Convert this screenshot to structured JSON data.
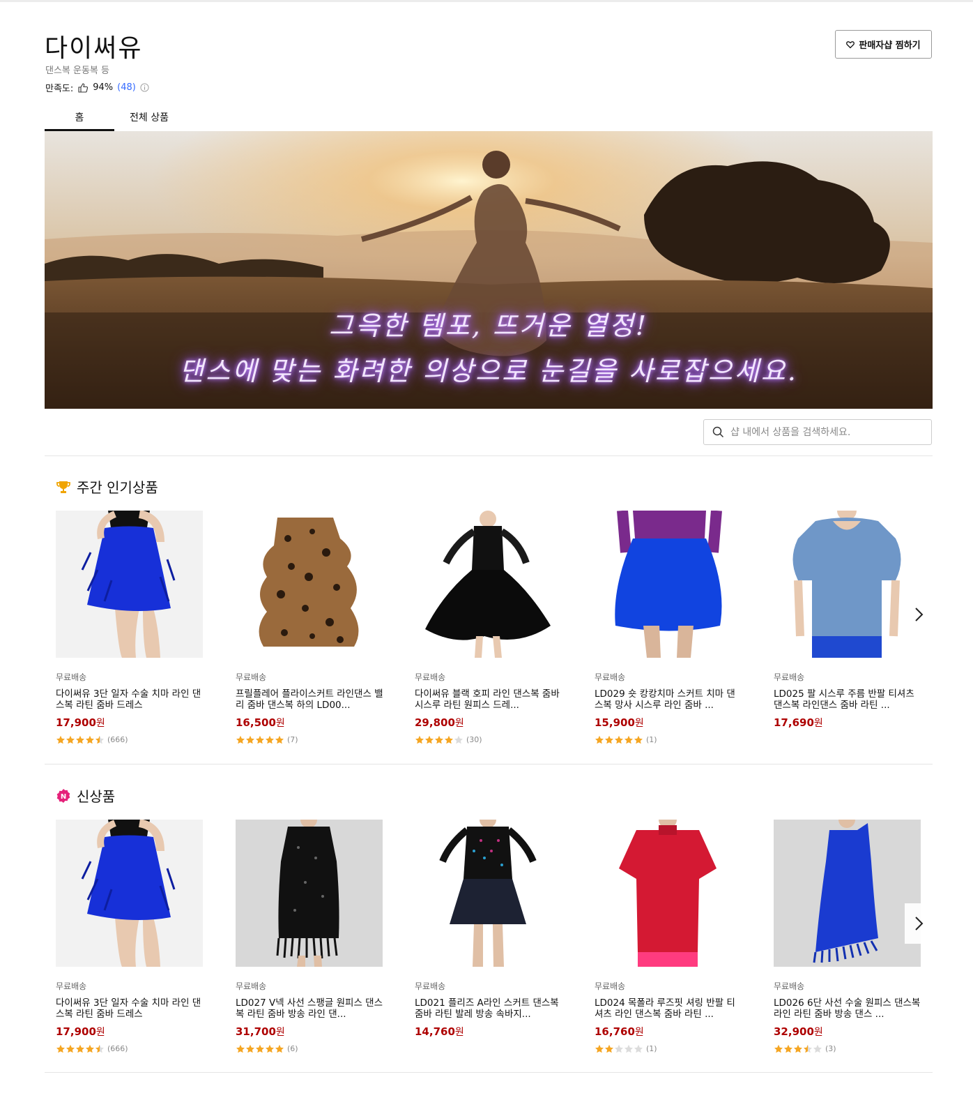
{
  "shop": {
    "name": "다이써유",
    "category": "댄스복 운동복 등",
    "satisfaction_label": "만족도:",
    "satisfaction_value": "94%",
    "satisfaction_count": "(48)",
    "favorite_button": "판매자샵 찜하기"
  },
  "tabs": [
    {
      "label": "홈",
      "active": true
    },
    {
      "label": "전체 상품",
      "active": false
    }
  ],
  "banner": {
    "line1": "그윽한 템포, 뜨거운 열정!",
    "line2": "댄스에 맞는 화려한 의상으로 눈길을 사로잡으세요."
  },
  "search": {
    "placeholder": "샵 내에서 상품을 검색하세요."
  },
  "sections": [
    {
      "title": "주간 인기상품",
      "icon": "trophy-icon",
      "products": [
        {
          "ship": "무료배송",
          "name": "다이써유 3단 일자 수술 치마 라인 댄스복 라틴 줌바 드레스",
          "price": "17,900",
          "currency": "원",
          "stars": 4.5,
          "reviews": "(666)",
          "image": "blue-fringe-skirt"
        },
        {
          "ship": "무료배송",
          "name": "프릴플레어 플라이스커트 라인댄스 밸리 줌바 댄스복 하의 LD00...",
          "price": "16,500",
          "currency": "원",
          "stars": 5,
          "reviews": "(7)",
          "image": "leopard-frill-skirt"
        },
        {
          "ship": "무료배송",
          "name": "다이써유 블랙 호피 라인 댄스복 줌바 시스루 라틴 원피스 드레...",
          "price": "29,800",
          "currency": "원",
          "stars": 4,
          "reviews": "(30)",
          "image": "black-dress"
        },
        {
          "ship": "무료배송",
          "name": "LD029 숏 캉캉치마 스커트 치마 댄스복 망사 시스루 라인 줌바 ...",
          "price": "15,900",
          "currency": "원",
          "stars": 5,
          "reviews": "(1)",
          "image": "blue-tutu"
        },
        {
          "ship": "무료배송",
          "name": "LD025 팔 시스루 주름 반팔 티셔츠 댄스복 라인댄스 줌바 라틴 ...",
          "price": "17,690",
          "currency": "원",
          "stars": 0,
          "reviews": "",
          "image": "blue-tshirt"
        }
      ]
    },
    {
      "title": "신상품",
      "icon": "new-badge-icon",
      "products": [
        {
          "ship": "무료배송",
          "name": "다이써유 3단 일자 수술 치마 라인 댄스복 라틴 줌바 드레스",
          "price": "17,900",
          "currency": "원",
          "stars": 4.5,
          "reviews": "(666)",
          "image": "blue-fringe-skirt"
        },
        {
          "ship": "무료배송",
          "name": "LD027 V넥 사선 스팽글 원피스 댄스복 라틴 줌바 방송 라인 댄...",
          "price": "31,700",
          "currency": "원",
          "stars": 5,
          "reviews": "(6)",
          "image": "sequin-dress"
        },
        {
          "ship": "무료배송",
          "name": "LD021 플리즈 A라인 스커트 댄스복 줌바 라틴 발레 방송 속바지...",
          "price": "14,760",
          "currency": "원",
          "stars": 0,
          "reviews": "",
          "image": "pleated-skirt"
        },
        {
          "ship": "무료배송",
          "name": "LD024 목폴라 루즈핏 셔링 반팔 티셔츠 라인 댄스복 줌바 라틴 ...",
          "price": "16,760",
          "currency": "원",
          "stars": 2,
          "reviews": "(1)",
          "image": "red-tshirt"
        },
        {
          "ship": "무료배송",
          "name": "LD026 6단 사선 수술 원피스 댄스복 라인 라틴 줌바 방송 댄스 ...",
          "price": "32,900",
          "currency": "원",
          "stars": 3.5,
          "reviews": "(3)",
          "image": "blue-fringe-dress"
        }
      ]
    }
  ],
  "colors": {
    "price": "#ae0000",
    "star": "#f5a623",
    "count_link": "#346aff",
    "trophy": "#f0a400",
    "new_badge": "#e5227a"
  }
}
